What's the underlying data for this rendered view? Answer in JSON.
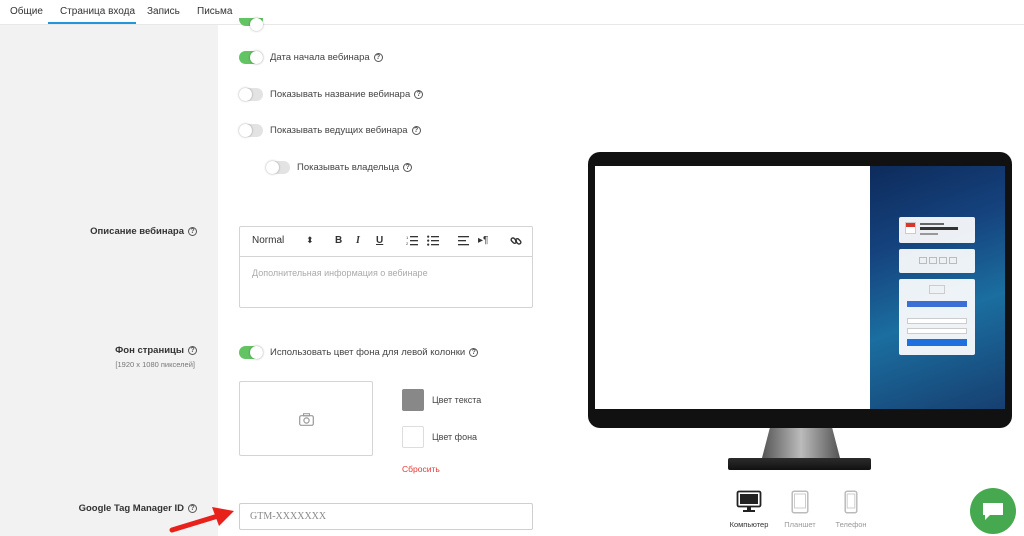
{
  "tabs": [
    {
      "label": "Общие"
    },
    {
      "label": "Страница входа"
    },
    {
      "label": "Запись"
    },
    {
      "label": "Письма"
    }
  ],
  "toggles": [
    {
      "label": "Дата начала вебинара",
      "state": "on"
    },
    {
      "label": "Показывать название вебинара",
      "state": "off"
    },
    {
      "label": "Показывать ведущих вебинара",
      "state": "off"
    },
    {
      "label": "Показывать владельца",
      "state": "off"
    }
  ],
  "description": {
    "label": "Описание вебинара",
    "format_select": "Normal",
    "placeholder": "Дополнительная информация о вебинаре"
  },
  "background": {
    "label": "Фон страницы",
    "sublabel": "[1920 x 1080 пикселей]",
    "toggle_label": "Использовать цвет фона для левой колонки",
    "toggle_state": "on",
    "text_color_label": "Цвет текста",
    "text_color": "#888888",
    "bg_color_label": "Цвет фона",
    "bg_color": "#ffffff",
    "reset_label": "Сбросить"
  },
  "gtm": {
    "label": "Google Tag Manager ID",
    "placeholder": "GTM-XXXXXXX"
  },
  "devices": [
    {
      "label": "Компьютер",
      "active": true
    },
    {
      "label": "Планшет",
      "active": false
    },
    {
      "label": "Телефон",
      "active": false
    }
  ],
  "colors": {
    "accent_blue": "#2196d8",
    "toggle_on": "#62c462",
    "reset_red": "#e53935",
    "chat_green": "#46a94f"
  }
}
